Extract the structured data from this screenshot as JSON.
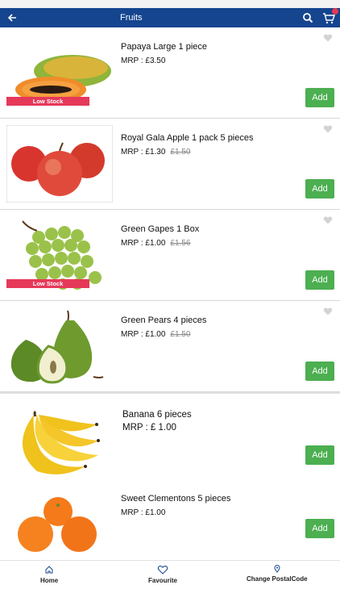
{
  "app_bar": {
    "title": "Fruits",
    "back_icon": "arrow-left-icon",
    "search_icon": "search-icon",
    "cart_icon": "cart-icon",
    "brand_color": "#15458f"
  },
  "products": [
    {
      "name": "Papaya Large 1 piece",
      "price": "MRP : £3.50",
      "old_price": "",
      "low_stock": "Low Stock",
      "add_label": "Add"
    },
    {
      "name": "Royal Gala Apple 1 pack 5 pieces",
      "price": "MRP : £1.30",
      "old_price": "£1.50",
      "low_stock": "",
      "add_label": "Add"
    },
    {
      "name": "Green Gapes 1 Box",
      "price": "MRP : £1.00",
      "old_price": "£1.56",
      "low_stock": "Low Stock",
      "add_label": "Add"
    },
    {
      "name": "Green Pears 4 pieces",
      "price": "MRP : £1.00",
      "old_price": "£1.50",
      "low_stock": "",
      "add_label": "Add"
    },
    {
      "name": "Banana 6 pieces",
      "price": "MRP : £ 1.00",
      "old_price": "",
      "low_stock": "",
      "add_label": "Add"
    },
    {
      "name": "Sweet Clementons 5 pieces",
      "price": "MRP : £1.00",
      "old_price": "",
      "low_stock": "",
      "add_label": "Add"
    }
  ],
  "bottom_nav": {
    "home": "Home",
    "favourite": "Favourite",
    "change_postal": "Change PostalCode"
  },
  "colors": {
    "add_button": "#4caf50",
    "low_stock": "#e6395a"
  }
}
